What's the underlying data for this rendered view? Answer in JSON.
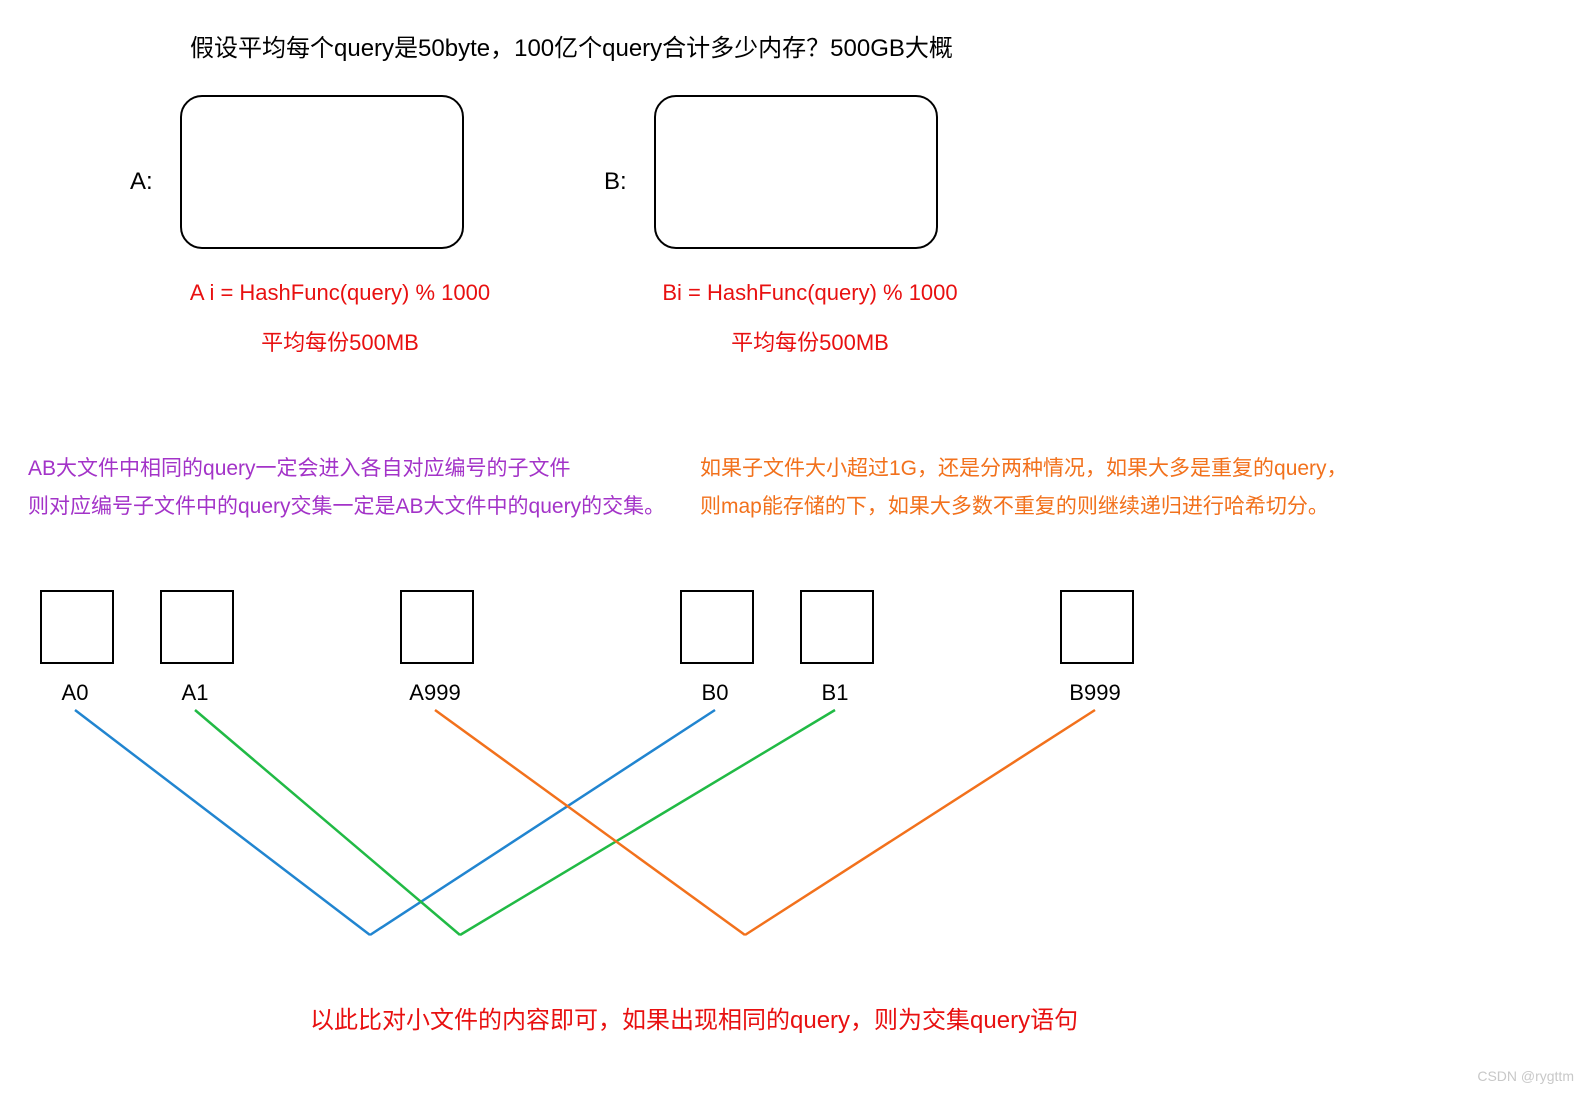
{
  "title": "假设平均每个query是50byte，100亿个query合计多少内存？500GB大概",
  "left": {
    "label": "A:",
    "formula": "A i  = HashFunc(query) % 1000",
    "avg": "平均每份500MB"
  },
  "right": {
    "label": "B:",
    "formula": "Bi  = HashFunc(query) % 1000",
    "avg": "平均每份500MB"
  },
  "purple_text": "AB大文件中相同的query一定会进入各自对应编号的子文件\n则对应编号子文件中的query交集一定是AB大文件中的query的交集。",
  "orange_text": "如果子文件大小超过1G，还是分两种情况，如果大多是重复的query，则map能存储的下，如果大多数不重复的则继续递归进行哈希切分。",
  "sub_files": {
    "a0": "A0",
    "a1": "A1",
    "a999": "A999",
    "b0": "B0",
    "b1": "B1",
    "b999": "B999"
  },
  "bottom_text": "以此比对小文件的内容即可，如果出现相同的query，则为交集query语句",
  "watermark": "CSDN @rygttm",
  "colors": {
    "red": "#e81010",
    "purple": "#a333c8",
    "orange": "#f2711c",
    "blue": "#2185d0",
    "green": "#21ba45",
    "line_orange": "#f2711c"
  }
}
